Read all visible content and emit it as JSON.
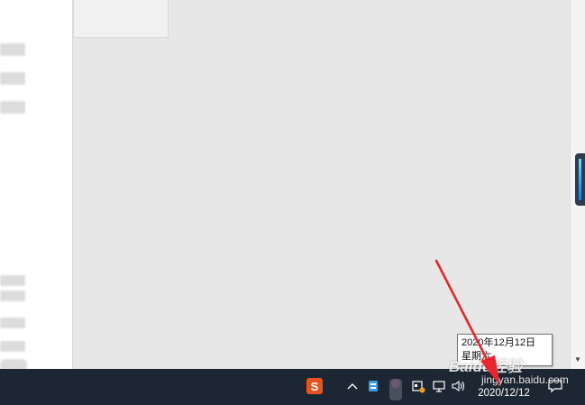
{
  "tooltip": {
    "line1": "2020年12月12日",
    "line2": "星期六"
  },
  "clock": {
    "time": "",
    "date": "2020/12/12"
  },
  "tray": {
    "overflow_icon": "chevron-up-icon",
    "sogou_label": "S",
    "icons": [
      "sogou-ime-icon",
      "chevron-up-icon",
      "bluetooth-usb-icon",
      "app-icon",
      "camera-icon",
      "network-icon",
      "volume-icon",
      "notification-icon"
    ]
  },
  "watermark": {
    "brand": "Baidu经验",
    "url": "jingyan.baidu.com"
  },
  "colors": {
    "taskbar": "#1d2733",
    "desktop": "#e7e7e7",
    "arrow": "#e8262b",
    "sogou": "#e8541e"
  }
}
